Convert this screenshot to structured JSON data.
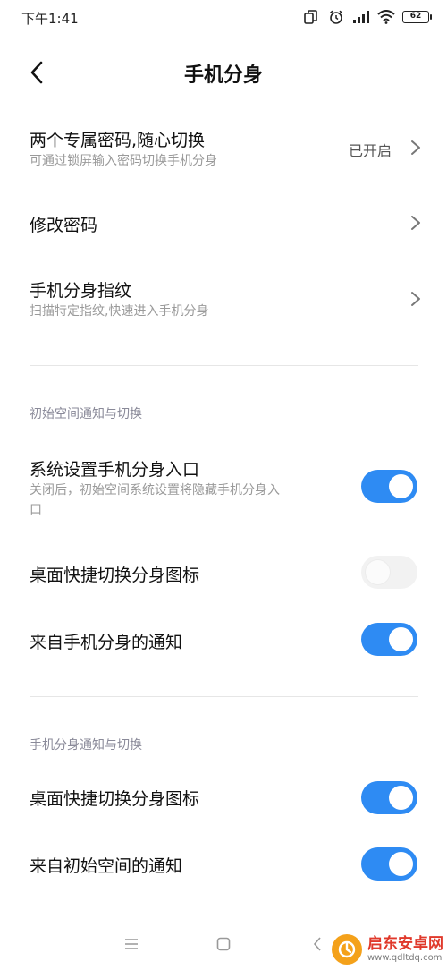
{
  "status_bar": {
    "time": "下午1:41",
    "battery": "62"
  },
  "header": {
    "title": "手机分身"
  },
  "rows": {
    "password": {
      "title": "两个专属密码,随心切换",
      "subtitle": "可通过锁屏输入密码切换手机分身",
      "value": "已开启"
    },
    "change_password": {
      "title": "修改密码"
    },
    "fingerprint": {
      "title": "手机分身指纹",
      "subtitle": "扫描特定指纹,快速进入手机分身"
    }
  },
  "section1": {
    "header": "初始空间通知与切换",
    "settings_entry": {
      "title": "系统设置手机分身入口",
      "subtitle_line1": "关闭后，初始空间系统设置将隐藏手机分身入",
      "subtitle_line2": "口",
      "enabled": true
    },
    "desktop_shortcut": {
      "title": "桌面快捷切换分身图标",
      "enabled": false
    },
    "notifications": {
      "title": "来自手机分身的通知",
      "enabled": true
    }
  },
  "section2": {
    "header": "手机分身通知与切换",
    "desktop_shortcut": {
      "title": "桌面快捷切换分身图标",
      "enabled": true
    },
    "notifications": {
      "title": "来自初始空间的通知",
      "enabled": true
    }
  },
  "colors": {
    "accent": "#2e8bf3",
    "toggle_off": "#f2f2f2",
    "subtitle": "#9a9a9a",
    "section_header": "#8a8a99"
  },
  "watermark": {
    "title": "启东安卓网",
    "url": "www.qdltdq.com"
  }
}
